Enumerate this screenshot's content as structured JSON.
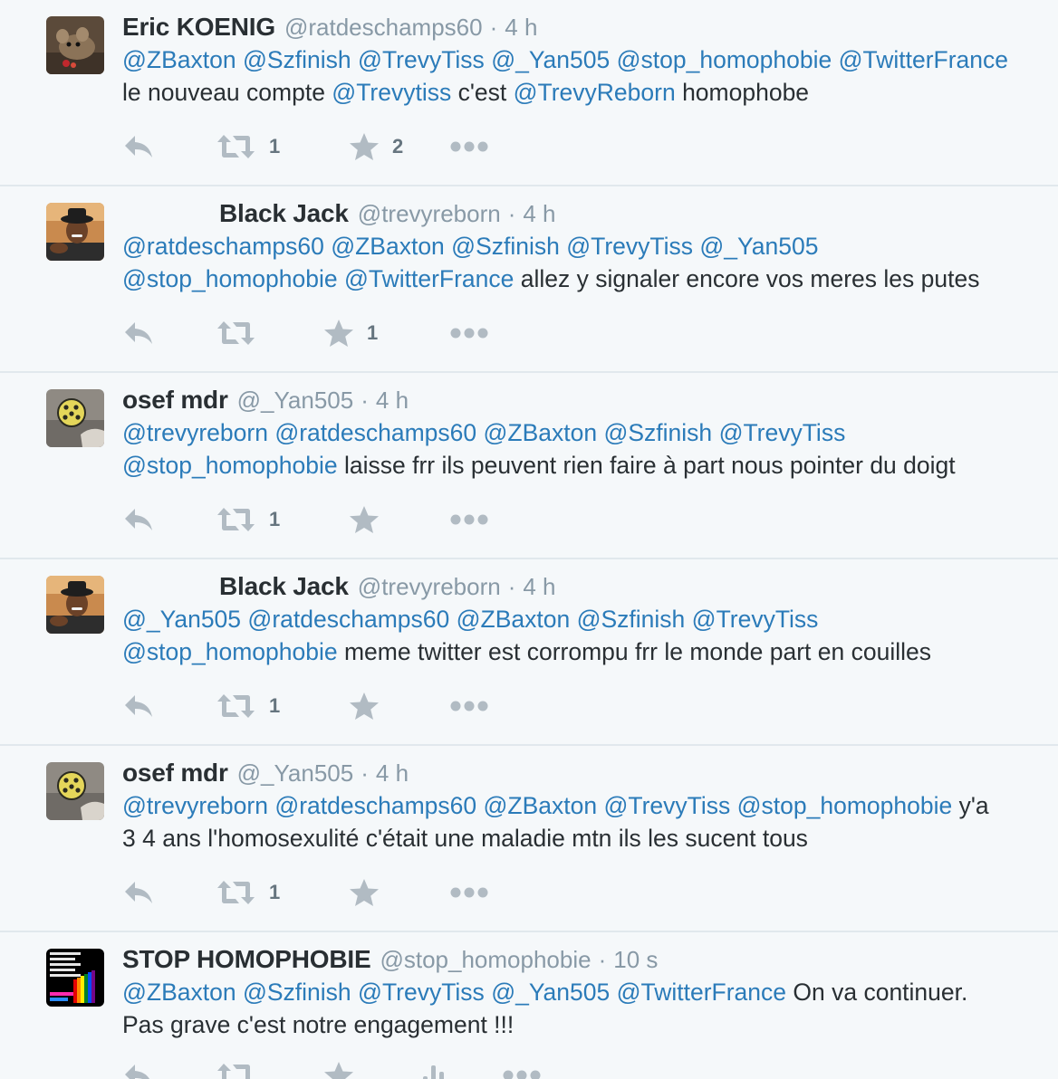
{
  "tweets": [
    {
      "fullname": "Eric KOENIG",
      "username": "@ratdeschamps60",
      "sep": "·",
      "time": "4 h",
      "indented": false,
      "avatar": "mouse-photo",
      "segments": [
        {
          "t": "@ZBaxton",
          "m": true
        },
        {
          "t": " ",
          "m": false
        },
        {
          "t": "@Szfinish",
          "m": true
        },
        {
          "t": " ",
          "m": false
        },
        {
          "t": "@TrevyTiss",
          "m": true
        },
        {
          "t": " ",
          "m": false
        },
        {
          "t": "@_Yan505",
          "m": true
        },
        {
          "t": " ",
          "m": false
        },
        {
          "t": "@stop_homophobie",
          "m": true
        },
        {
          "t": " ",
          "m": false
        },
        {
          "t": "@TwitterFrance",
          "m": true
        },
        {
          "t": "\n",
          "m": false
        },
        {
          "t": "le nouveau compte ",
          "m": false
        },
        {
          "t": "@Trevytiss",
          "m": true
        },
        {
          "t": " c'est ",
          "m": false
        },
        {
          "t": "@TrevyReborn",
          "m": true
        },
        {
          "t": " homophobe",
          "m": false
        }
      ],
      "retweets": "1",
      "favorites": "2",
      "layout": "a"
    },
    {
      "fullname": "Black Jack",
      "username": "@trevyreborn",
      "sep": "·",
      "time": "4 h",
      "indented": true,
      "avatar": "man-hat-photo",
      "segments": [
        {
          "t": "@ratdeschamps60",
          "m": true
        },
        {
          "t": " ",
          "m": false
        },
        {
          "t": "@ZBaxton",
          "m": true
        },
        {
          "t": " ",
          "m": false
        },
        {
          "t": "@Szfinish",
          "m": true
        },
        {
          "t": " ",
          "m": false
        },
        {
          "t": "@TrevyTiss",
          "m": true
        },
        {
          "t": " ",
          "m": false
        },
        {
          "t": "@_Yan505",
          "m": true
        },
        {
          "t": "\n",
          "m": false
        },
        {
          "t": "@stop_homophobie",
          "m": true
        },
        {
          "t": " ",
          "m": false
        },
        {
          "t": "@TwitterFrance",
          "m": true
        },
        {
          "t": " allez y signaler encore vos meres les putes",
          "m": false
        }
      ],
      "retweets": "",
      "favorites": "1",
      "layout": "b"
    },
    {
      "fullname": "osef mdr",
      "username": "@_Yan505",
      "sep": "·",
      "time": "4 h",
      "indented": false,
      "avatar": "ball-photo",
      "segments": [
        {
          "t": "@trevyreborn",
          "m": true
        },
        {
          "t": " ",
          "m": false
        },
        {
          "t": "@ratdeschamps60",
          "m": true
        },
        {
          "t": " ",
          "m": false
        },
        {
          "t": "@ZBaxton",
          "m": true
        },
        {
          "t": " ",
          "m": false
        },
        {
          "t": "@Szfinish",
          "m": true
        },
        {
          "t": " ",
          "m": false
        },
        {
          "t": "@TrevyTiss",
          "m": true
        },
        {
          "t": "\n",
          "m": false
        },
        {
          "t": "@stop_homophobie",
          "m": true
        },
        {
          "t": " laisse frr ils peuvent rien faire à part nous pointer du doigt",
          "m": false
        }
      ],
      "retweets": "1",
      "favorites": "",
      "layout": "a"
    },
    {
      "fullname": "Black Jack",
      "username": "@trevyreborn",
      "sep": "·",
      "time": "4 h",
      "indented": true,
      "avatar": "man-hat-photo",
      "segments": [
        {
          "t": "@_Yan505",
          "m": true
        },
        {
          "t": " ",
          "m": false
        },
        {
          "t": "@ratdeschamps60",
          "m": true
        },
        {
          "t": " ",
          "m": false
        },
        {
          "t": "@ZBaxton",
          "m": true
        },
        {
          "t": " ",
          "m": false
        },
        {
          "t": "@Szfinish",
          "m": true
        },
        {
          "t": " ",
          "m": false
        },
        {
          "t": "@TrevyTiss",
          "m": true
        },
        {
          "t": "\n",
          "m": false
        },
        {
          "t": "@stop_homophobie",
          "m": true
        },
        {
          "t": " meme twitter est corrompu frr le monde part en couilles",
          "m": false
        }
      ],
      "retweets": "1",
      "favorites": "",
      "layout": "a"
    },
    {
      "fullname": "osef mdr",
      "username": "@_Yan505",
      "sep": "·",
      "time": "4 h",
      "indented": false,
      "avatar": "ball-photo",
      "segments": [
        {
          "t": "@trevyreborn",
          "m": true
        },
        {
          "t": " ",
          "m": false
        },
        {
          "t": "@ratdeschamps60",
          "m": true
        },
        {
          "t": " ",
          "m": false
        },
        {
          "t": "@ZBaxton",
          "m": true
        },
        {
          "t": " ",
          "m": false
        },
        {
          "t": "@TrevyTiss",
          "m": true
        },
        {
          "t": " ",
          "m": false
        },
        {
          "t": "@stop_homophobie",
          "m": true
        },
        {
          "t": " y'a",
          "m": false
        },
        {
          "t": "\n",
          "m": false
        },
        {
          "t": "3 4 ans l'homosexulité c'était une maladie mtn ils les sucent tous",
          "m": false
        }
      ],
      "retweets": "1",
      "favorites": "",
      "layout": "a"
    },
    {
      "fullname": "STOP HOMOPHOBIE",
      "username": "@stop_homophobie",
      "sep": "·",
      "time": "10 s",
      "indented": false,
      "avatar": "stop-homophobie-logo",
      "segments": [
        {
          "t": "@ZBaxton",
          "m": true
        },
        {
          "t": " ",
          "m": false
        },
        {
          "t": "@Szfinish",
          "m": true
        },
        {
          "t": " ",
          "m": false
        },
        {
          "t": "@TrevyTiss",
          "m": true
        },
        {
          "t": " ",
          "m": false
        },
        {
          "t": "@_Yan505",
          "m": true
        },
        {
          "t": " ",
          "m": false
        },
        {
          "t": "@TwitterFrance",
          "m": true
        },
        {
          "t": " On va continuer.",
          "m": false
        },
        {
          "t": "\n",
          "m": false
        },
        {
          "t": "Pas grave c'est notre engagement !!!",
          "m": false
        }
      ],
      "retweets": "",
      "favorites": "",
      "layout": "c"
    }
  ],
  "colors": {
    "background": "#f5f8fa",
    "mention": "#2b7bb9",
    "muted": "#8899a6",
    "icon": "#b1bbc3",
    "text": "#292f33",
    "divider": "#e1e8ed"
  },
  "icons": {
    "reply": "reply-icon",
    "retweet": "retweet-icon",
    "favorite": "star-icon",
    "more": "more-dots-icon",
    "analytics": "analytics-icon"
  }
}
